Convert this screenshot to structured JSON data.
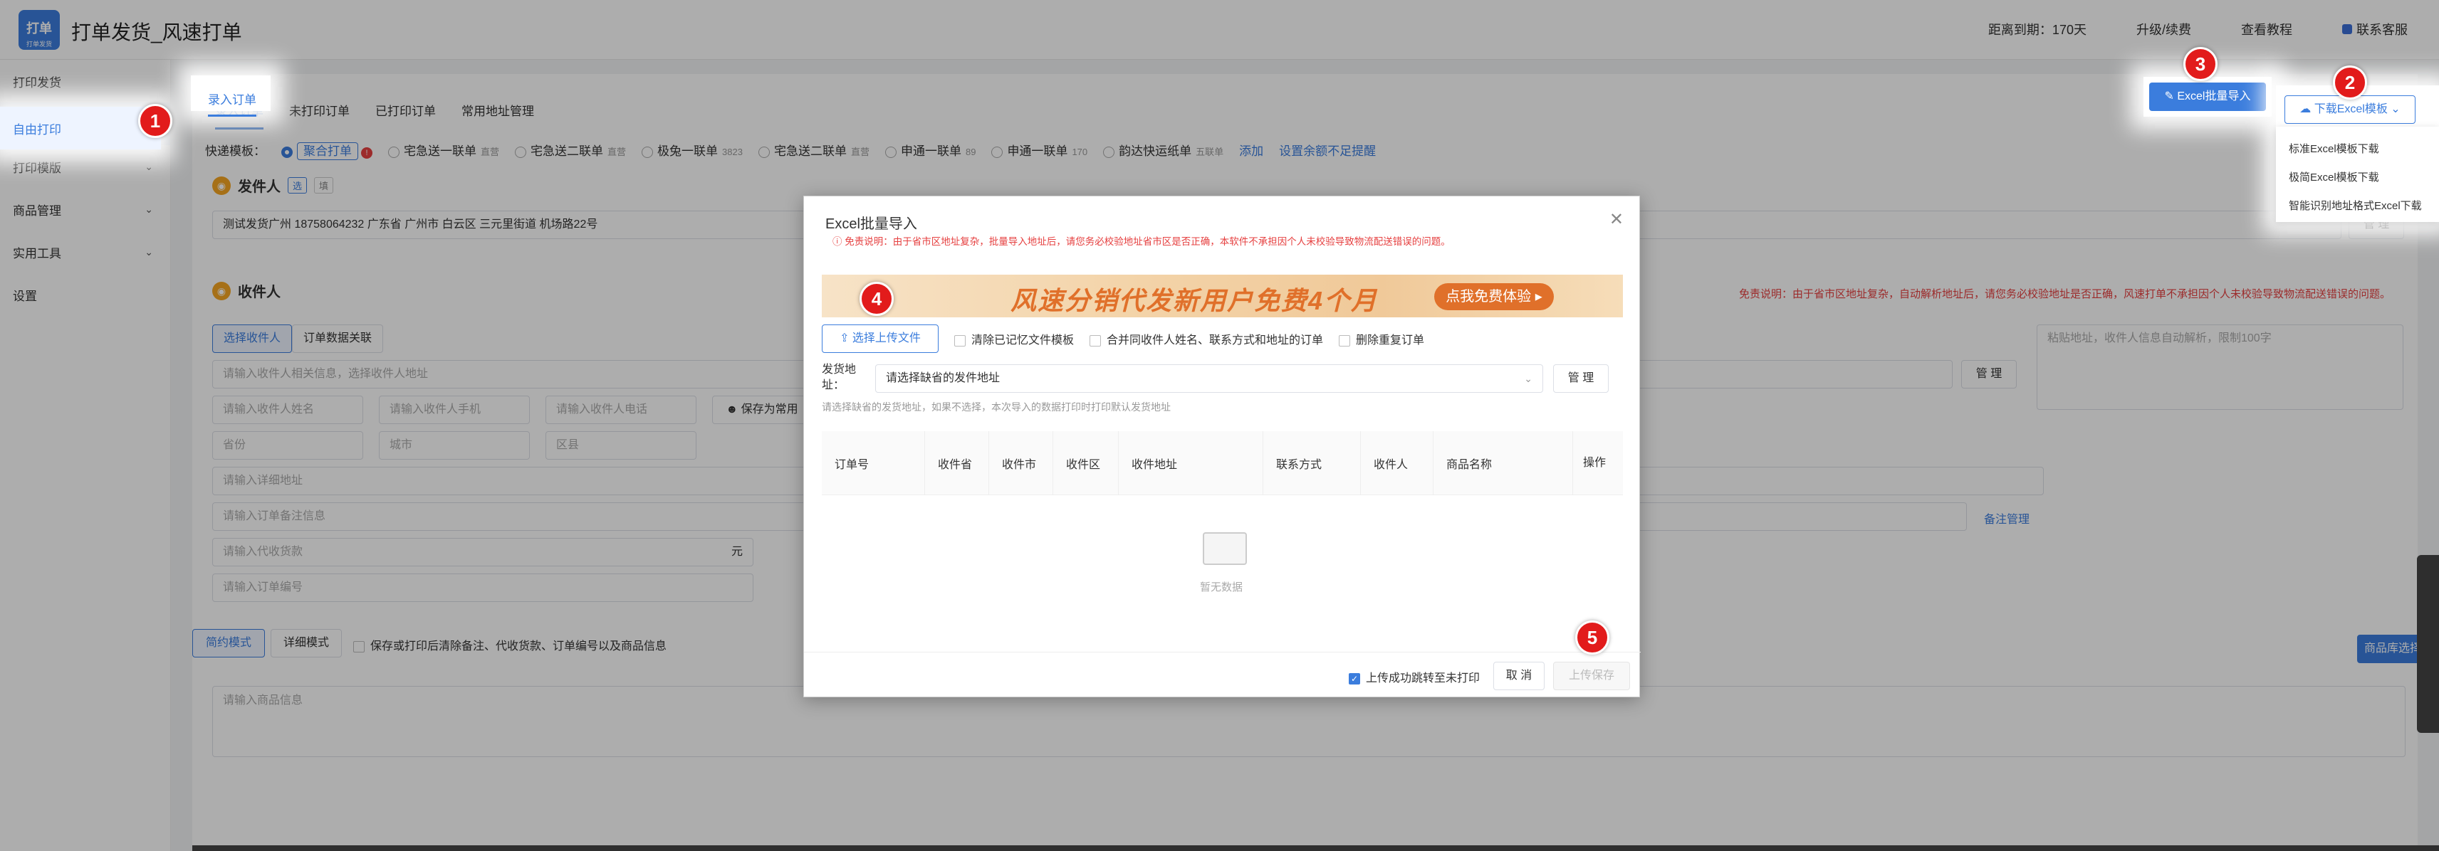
{
  "app": {
    "title": "打单发货_风速打单",
    "logo_text": "打单",
    "logo_sub": "打单发货"
  },
  "topbar": {
    "expiry": "距离到期：170天",
    "upgrade": "升级/续费",
    "tutorial": "查看教程",
    "support": "联系客服"
  },
  "sidebar": {
    "items": [
      {
        "label": "打印发货",
        "has_children": false
      },
      {
        "label": "自由打印",
        "has_children": false,
        "active": true
      },
      {
        "label": "打印模版",
        "has_children": true
      },
      {
        "label": "商品管理",
        "has_children": true
      },
      {
        "label": "实用工具",
        "has_children": true
      },
      {
        "label": "设置",
        "has_children": false
      }
    ]
  },
  "tabs": [
    "录入订单",
    "未打印订单",
    "已打印订单",
    "常用地址管理"
  ],
  "templates": {
    "label": "快递模板：",
    "items": [
      {
        "name": "聚合打单",
        "selected": true,
        "badge": "!"
      },
      {
        "name": "宅急送一联单",
        "sub": "直营"
      },
      {
        "name": "宅急送二联单",
        "sub": "直营"
      },
      {
        "name": "极兔一联单",
        "sub": "3823"
      },
      {
        "name": "宅急送二联单",
        "sub": "直营"
      },
      {
        "name": "申通一联单",
        "sub": "89"
      },
      {
        "name": "申通一联单",
        "sub": "170"
      },
      {
        "name": "韵达快运纸单",
        "sub": "五联单"
      }
    ],
    "add": "添加",
    "low_balance": "设置余额不足提醒"
  },
  "sender": {
    "title": "发件人",
    "tag_select": "选",
    "tag_fill": "填",
    "value": "测试发货广州 18758064232 广东省 广州市 白云区 三元里街道 机场路22号",
    "manage": "管 理"
  },
  "receiver": {
    "title": "收件人",
    "tab_select": "选择收件人",
    "tab_link": "订单数据关联",
    "search_placeholder": "请输入收件人相关信息，选择收件人地址",
    "manage": "管 理",
    "name_placeholder": "请输入收件人姓名",
    "phone_placeholder": "请输入收件人手机",
    "tel_placeholder": "请输入收件人电话",
    "save_common": "保存为常用",
    "province": "省份",
    "city": "城市",
    "district": "区县",
    "detail_placeholder": "请输入详细地址",
    "remark_placeholder": "请输入订单备注信息",
    "remark_manage": "备注管理",
    "cod_placeholder": "请输入代收货款",
    "cod_unit": "元",
    "order_no_placeholder": "请输入订单编号",
    "smart_placeholder": "粘贴地址，收件人信息自动解析，限制100字",
    "disclaimer": "免责说明：由于省市区地址复杂，自动解析地址后，请您务必校验地址是否正确，风速打单不承担因个人未校验导致物流配送错误的问题。"
  },
  "goods": {
    "mode_simple": "简约模式",
    "mode_detail": "详细模式",
    "clear_after_print": "保存或打印后清除备注、代收货款、订单编号以及商品信息",
    "goods_placeholder": "请输入商品信息",
    "library_select": "商品库选择"
  },
  "actions": {
    "excel_import": "Excel批量导入",
    "download_template": "下载Excel模板",
    "download_menu": [
      "标准Excel模板下载",
      "极简Excel模板下载",
      "智能识别地址格式Excel下载"
    ]
  },
  "modal": {
    "title": "Excel批量导入",
    "warning": "免责说明：由于省市区地址复杂，批量导入地址后，请您务必校验地址省市区是否正确，本软件不承担因个人未校验导致物流配送错误的问题。",
    "banner_text": "风速分销代发新用户免费4个月",
    "banner_button": "点我免费体验",
    "upload_button": "选择上传文件",
    "options": [
      {
        "label": "清除已记忆文件模板",
        "checked": false
      },
      {
        "label": "合并同收件人姓名、联系方式和地址的订单",
        "checked": false
      },
      {
        "label": "删除重复订单",
        "checked": false
      }
    ],
    "address_label": "发货地址：",
    "address_placeholder": "请选择缺省的发件地址",
    "address_manage": "管 理",
    "address_hint": "请选择缺省的发货地址，如果不选择，本次导入的数据打印时打印默认发货地址",
    "columns": [
      "订单号",
      "收件省",
      "收件市",
      "收件区",
      "收件地址",
      "联系方式",
      "收件人",
      "商品名称",
      "操作"
    ],
    "empty_text": "暂无数据",
    "jump_after_upload": "上传成功跳转至未打印",
    "jump_checked": true,
    "cancel": "取 消",
    "save": "上传保存"
  },
  "markers": [
    "1",
    "2",
    "3",
    "4",
    "5"
  ],
  "colors": {
    "accent": "#3b7ddd",
    "danger": "#e64040",
    "marker": "#e21b1b",
    "banner": "#e0702a"
  }
}
